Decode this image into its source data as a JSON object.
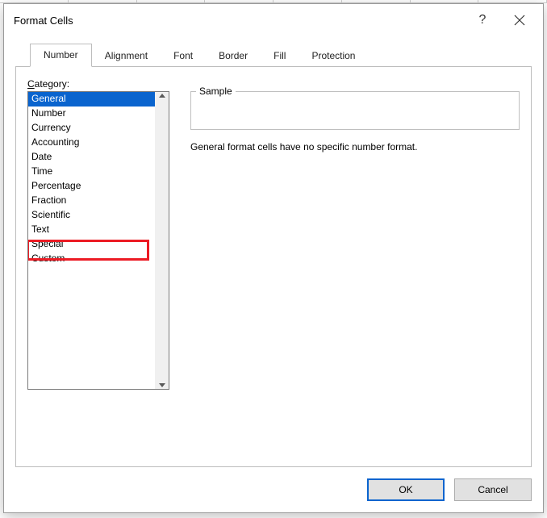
{
  "dialog": {
    "title": "Format Cells",
    "help_char": "?",
    "tabs": [
      "Number",
      "Alignment",
      "Font",
      "Border",
      "Fill",
      "Protection"
    ],
    "active_tab_index": 0
  },
  "category": {
    "label_prefix_underlined": "C",
    "label_rest": "ategory:",
    "items": [
      "General",
      "Number",
      "Currency",
      "Accounting",
      "Date",
      "Time",
      "Percentage",
      "Fraction",
      "Scientific",
      "Text",
      "Special",
      "Custom"
    ],
    "selected_index": 0,
    "highlighted_index": 11
  },
  "sample": {
    "label": "Sample",
    "value": ""
  },
  "description": "General format cells have no specific number format.",
  "buttons": {
    "ok": "OK",
    "cancel": "Cancel"
  }
}
